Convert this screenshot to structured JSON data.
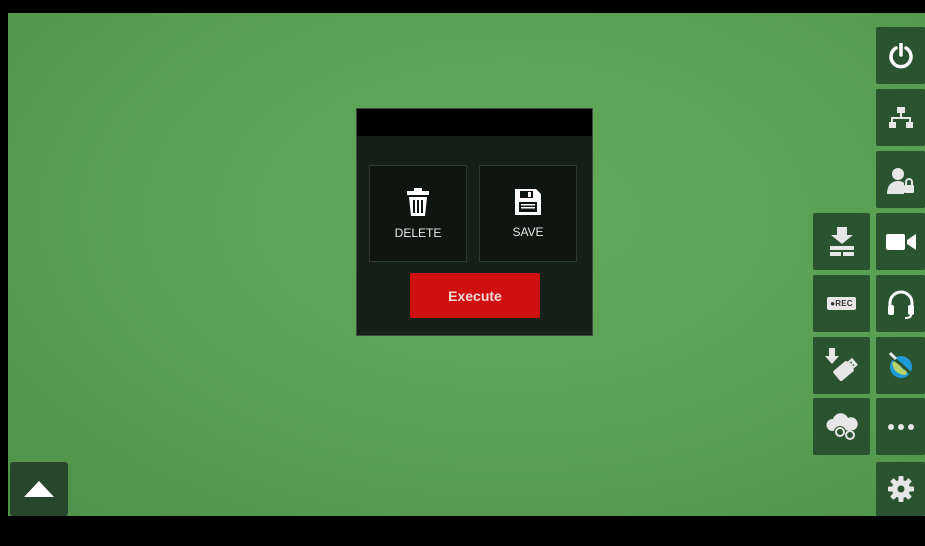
{
  "popup": {
    "delete_label": "DELETE",
    "save_label": "SAVE",
    "execute_label": "Execute"
  },
  "sidebar_left_column": [
    {
      "icon": "download-layers-icon"
    },
    {
      "icon": "rec-icon",
      "label": "●REC"
    },
    {
      "icon": "usb-drive-icon"
    },
    {
      "icon": "cloud-settings-icon"
    }
  ],
  "sidebar_right_column": [
    {
      "icon": "power-icon"
    },
    {
      "icon": "network-icon"
    },
    {
      "icon": "user-lock-icon"
    },
    {
      "icon": "video-camera-icon"
    },
    {
      "icon": "headset-icon"
    },
    {
      "icon": "globe-satellite-icon"
    },
    {
      "icon": "more-icon"
    },
    {
      "icon": "gear-icon"
    }
  ],
  "colors": {
    "background": "#5aa054",
    "tile": "#2a5330",
    "execute": "#d01010",
    "accent_blue": "#1e9bd7"
  }
}
